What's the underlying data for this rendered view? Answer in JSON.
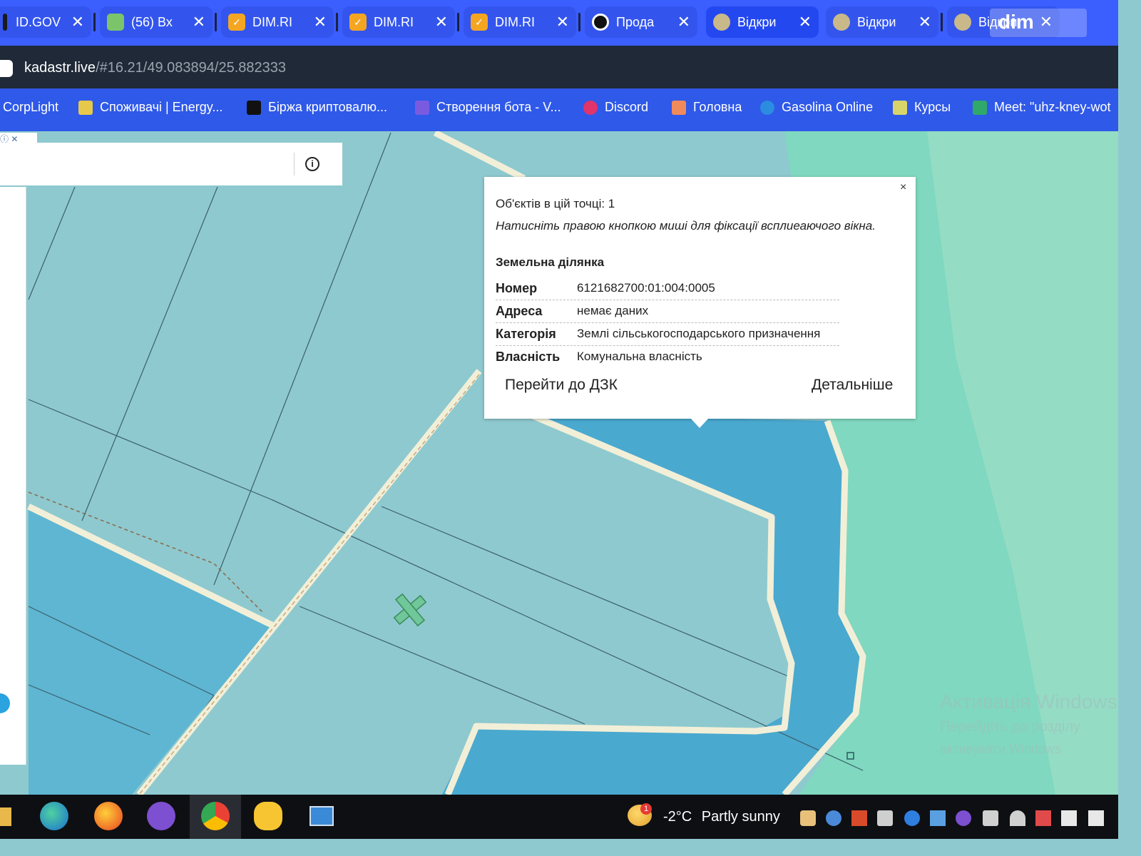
{
  "tabs": [
    {
      "label": "ID.GOV",
      "icon": "gov-icon"
    },
    {
      "label": "(56) Вх",
      "icon": "mail-icon"
    },
    {
      "label": "DIM.RI",
      "icon": "dim-ria-icon"
    },
    {
      "label": "DIM.RI",
      "icon": "dim-ria-icon"
    },
    {
      "label": "DIM.RI",
      "icon": "dim-ria-icon"
    },
    {
      "label": "Прода",
      "icon": "target-icon"
    },
    {
      "label": "Відкри",
      "icon": "kadastr-icon"
    },
    {
      "label": "Відкри",
      "icon": "kadastr-icon"
    },
    {
      "label": "Відкри",
      "icon": "kadastr-icon"
    }
  ],
  "address": {
    "domain": "kadastr.live",
    "path": "/#16.21/49.083894/25.882333"
  },
  "bookmarks": [
    {
      "label": "CorpLight"
    },
    {
      "label": "Споживачі | Energy..."
    },
    {
      "label": "Біржа криптовалю..."
    },
    {
      "label": "Створення бота - V..."
    },
    {
      "label": "Discord"
    },
    {
      "label": "Головна"
    },
    {
      "label": "Gasolina Online"
    },
    {
      "label": "Курсы"
    },
    {
      "label": "Meet: \"uhz-kney-wot"
    }
  ],
  "popup": {
    "close": "×",
    "objects_count": "Об'єктів в цій точці: 1",
    "hint": "Натисніть правою кнопкою миші для фіксації всплиеаючого вікна.",
    "section_title": "Земельна ділянка",
    "rows": [
      {
        "key": "Номер",
        "value": "6121682700:01:004:0005"
      },
      {
        "key": "Адреса",
        "value": "немає даних"
      },
      {
        "key": "Категорія",
        "value": "Землі сільськогосподарського призначення"
      },
      {
        "key": "Власність",
        "value": "Комунальна власність"
      }
    ],
    "link_dzk": "Перейти до ДЗК",
    "link_more": "Детальніше"
  },
  "watermark": {
    "line1": "Активація Windows",
    "line2": "Перейдіть до розділу",
    "line3": "активувати Windows"
  },
  "logo": "dim",
  "taskbar": {
    "temperature": "-2°C",
    "weather": "Partly sunny",
    "weather_badge": "1"
  },
  "colors": {
    "tabstrip": "#3b5eff",
    "bookmarks": "#2f59e8",
    "parcel_light": "#8ec9cf",
    "parcel_dark": "#4aa9cf",
    "road": "#f2efd8",
    "meadow": "#7fd8bf"
  }
}
